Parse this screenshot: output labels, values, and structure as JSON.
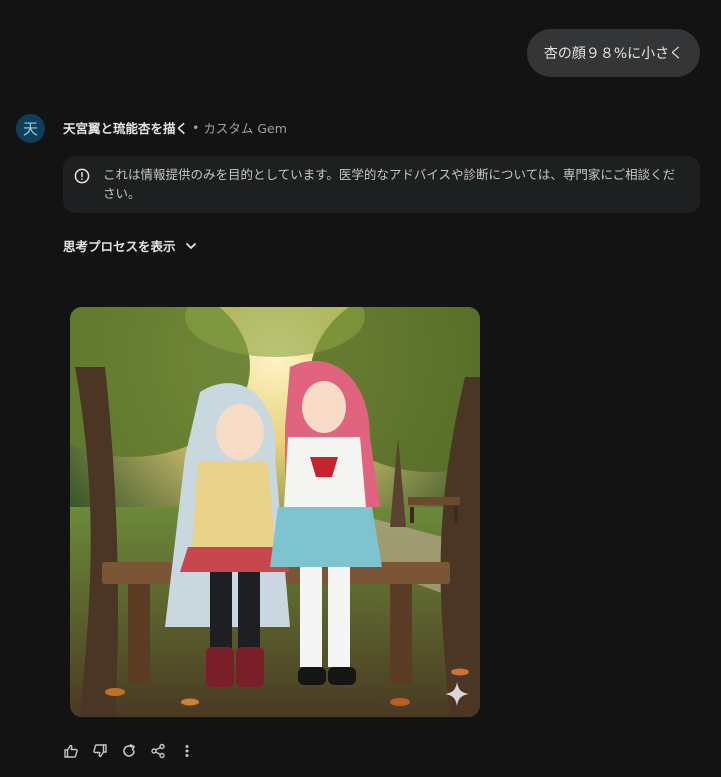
{
  "user_message": {
    "text": "杏の顔９８%に小さく"
  },
  "assistant": {
    "avatar_text": "天",
    "gem_name": "天宮翼と琉能杏を描く",
    "separator": "•",
    "gem_type": "カスタム Gem",
    "disclaimer": "これは情報提供のみを目的としています。医学的なアドバイスや診断については、専門家にご相談ください。",
    "thinking_toggle": "思考プロセスを表示"
  },
  "icons": {
    "avatar": "gem-avatar",
    "disclaimer": "info-circle-icon",
    "thinking": "chevron-down-icon",
    "watermark": "sparkle-icon",
    "actions": [
      "thumbs-up-icon",
      "thumbs-down-icon",
      "redo-icon",
      "share-icon",
      "more-vert-icon"
    ]
  },
  "colors": {
    "background": "#131314",
    "bubble": "#333537",
    "card": "#1e1f20",
    "avatar_bg": "#0f3f58"
  }
}
